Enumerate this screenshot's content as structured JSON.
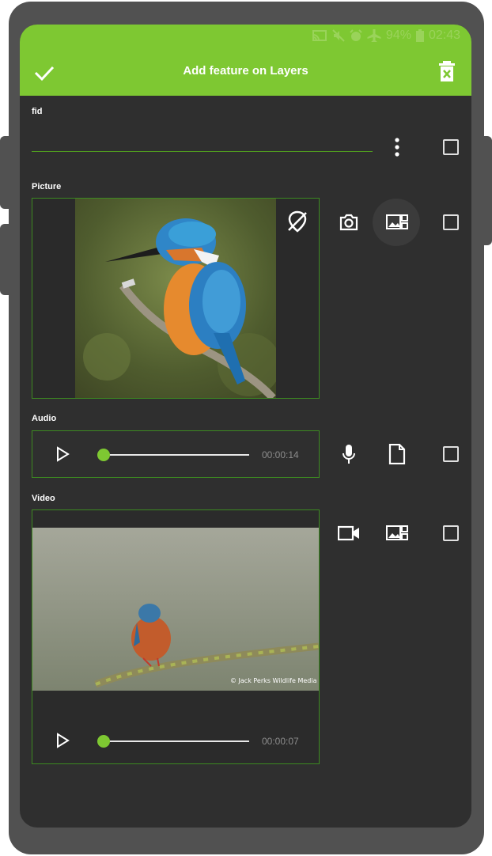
{
  "status_bar": {
    "battery": "94%",
    "time": "02:43"
  },
  "app_bar": {
    "title": "Add feature on Layers",
    "confirm_icon": "check-icon",
    "delete_icon": "delete-form-icon"
  },
  "fields": {
    "fid": {
      "label": "fid",
      "value": ""
    },
    "picture": {
      "label": "Picture"
    },
    "audio": {
      "label": "Audio",
      "time": "00:00:14",
      "progress": 0.0
    },
    "video": {
      "label": "Video",
      "time": "00:00:07",
      "progress": 0.0,
      "watermark": "© Jack Perks Wildlife Media"
    }
  },
  "colors": {
    "accent": "#7ec832",
    "background": "#2f2f2f",
    "frame_border": "#3d8a21"
  }
}
